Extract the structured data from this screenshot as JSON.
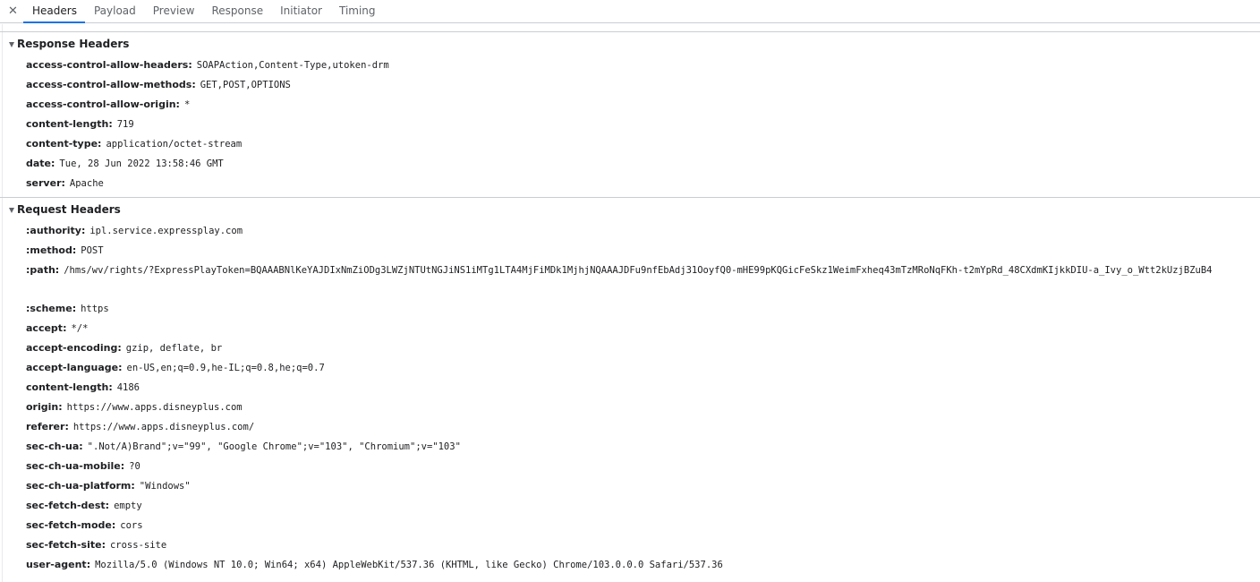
{
  "tabs": {
    "close": "✕",
    "items": [
      "Headers",
      "Payload",
      "Preview",
      "Response",
      "Initiator",
      "Timing"
    ]
  },
  "response_headers": {
    "title": "Response Headers",
    "rows": [
      {
        "name": "access-control-allow-headers",
        "value": "SOAPAction,Content-Type,utoken-drm"
      },
      {
        "name": "access-control-allow-methods",
        "value": "GET,POST,OPTIONS"
      },
      {
        "name": "access-control-allow-origin",
        "value": "*"
      },
      {
        "name": "content-length",
        "value": "719"
      },
      {
        "name": "content-type",
        "value": "application/octet-stream"
      },
      {
        "name": "date",
        "value": "Tue, 28 Jun 2022 13:58:46 GMT"
      },
      {
        "name": "server",
        "value": "Apache"
      }
    ]
  },
  "request_headers": {
    "title": "Request Headers",
    "rows": [
      {
        "name": ":authority",
        "value": "ipl.service.expressplay.com"
      },
      {
        "name": ":method",
        "value": "POST"
      },
      {
        "name": ":path",
        "value": "/hms/wv/rights/?ExpressPlayToken=BQAAABNlKeYAJDIxNmZiODg3LWZjNTUtNGJiNS1iMTg1LTA4MjFiMDk1MjhjNQAAAJDFu9nfEbAdj31OoyfQ0-mHE99pKQGicFeSkz1WeimFxheq43mTzMRoNqFKh-t2mYpRd_48CXdmKIjkkDIU-a_Ivy_o_Wtt2kUzjBZuB4"
      },
      {
        "name": ":scheme",
        "value": "https"
      },
      {
        "name": "accept",
        "value": "*/*"
      },
      {
        "name": "accept-encoding",
        "value": "gzip, deflate, br"
      },
      {
        "name": "accept-language",
        "value": "en-US,en;q=0.9,he-IL;q=0.8,he;q=0.7"
      },
      {
        "name": "content-length",
        "value": "4186"
      },
      {
        "name": "origin",
        "value": "https://www.apps.disneyplus.com"
      },
      {
        "name": "referer",
        "value": "https://www.apps.disneyplus.com/"
      },
      {
        "name": "sec-ch-ua",
        "value": "\".Not/A)Brand\";v=\"99\", \"Google Chrome\";v=\"103\", \"Chromium\";v=\"103\""
      },
      {
        "name": "sec-ch-ua-mobile",
        "value": "?0"
      },
      {
        "name": "sec-ch-ua-platform",
        "value": "\"Windows\""
      },
      {
        "name": "sec-fetch-dest",
        "value": "empty"
      },
      {
        "name": "sec-fetch-mode",
        "value": "cors"
      },
      {
        "name": "sec-fetch-site",
        "value": "cross-site"
      },
      {
        "name": "user-agent",
        "value": "Mozilla/5.0 (Windows NT 10.0; Win64; x64) AppleWebKit/537.36 (KHTML, like Gecko) Chrome/103.0.0.0 Safari/537.36"
      }
    ]
  },
  "colors": {
    "accent": "#1a73e8",
    "border": "#cacdd1",
    "text": "#202124",
    "muted": "#5f6368"
  }
}
